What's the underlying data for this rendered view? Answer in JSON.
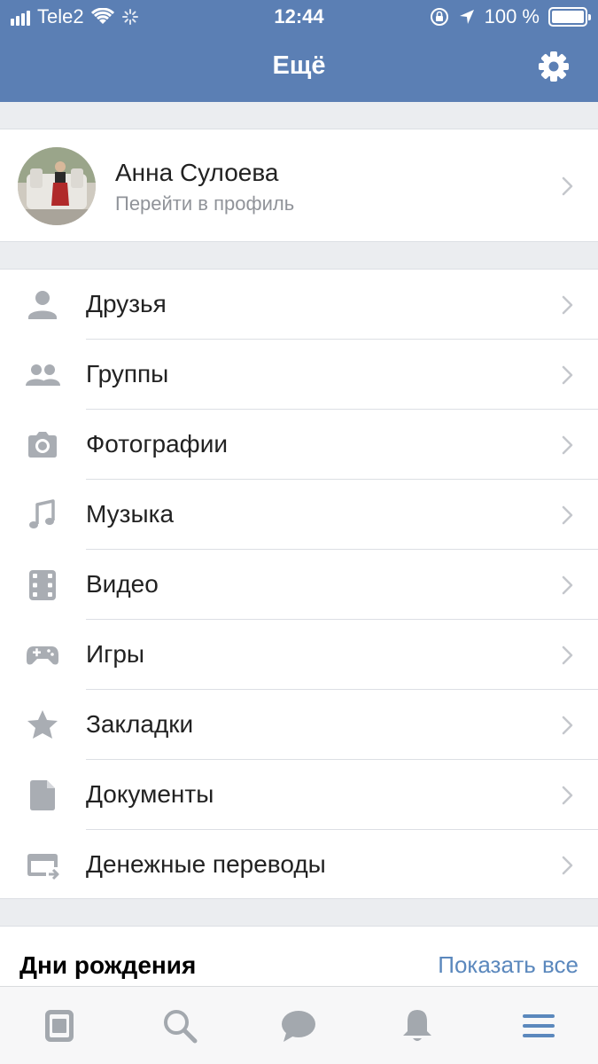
{
  "status_bar": {
    "carrier": "Tele2",
    "time": "12:44",
    "battery": "100 %"
  },
  "nav": {
    "title": "Ещё",
    "settings_icon": "gear-icon"
  },
  "profile": {
    "name": "Анна Сулоева",
    "subtitle": "Перейти в профиль"
  },
  "menu": {
    "items": [
      {
        "label": "Друзья",
        "icon": "person-icon"
      },
      {
        "label": "Группы",
        "icon": "people-icon"
      },
      {
        "label": "Фотографии",
        "icon": "camera-icon"
      },
      {
        "label": "Музыка",
        "icon": "music-note-icon"
      },
      {
        "label": "Видео",
        "icon": "film-icon"
      },
      {
        "label": "Игры",
        "icon": "gamepad-icon"
      },
      {
        "label": "Закладки",
        "icon": "star-icon"
      },
      {
        "label": "Документы",
        "icon": "document-icon"
      },
      {
        "label": "Денежные переводы",
        "icon": "card-transfer-icon"
      }
    ]
  },
  "birthdays": {
    "title": "Дни рождения",
    "show_all": "Показать все"
  },
  "tabbar": {
    "tabs": [
      {
        "icon": "news-icon",
        "active": false
      },
      {
        "icon": "search-icon",
        "active": false
      },
      {
        "icon": "messages-icon",
        "active": false
      },
      {
        "icon": "bell-icon",
        "active": false
      },
      {
        "icon": "menu-icon",
        "active": true
      }
    ]
  },
  "colors": {
    "header": "#5b7fb4",
    "icon_gray": "#a9adb3",
    "link_blue": "#5b88bd",
    "active_tab": "#5b88bd"
  }
}
